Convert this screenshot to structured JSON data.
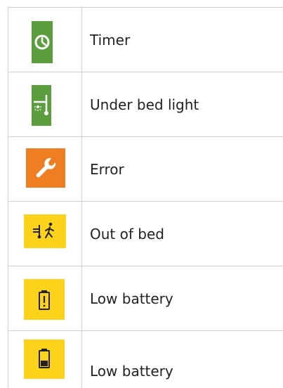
{
  "colors": {
    "green": "#5a9e3e",
    "orange": "#ef7d22",
    "yellow": "#fdd21a",
    "grid": "#cfcfcf",
    "text": "#222222"
  },
  "legend": {
    "rows": [
      {
        "label": "Timer",
        "icon": "timer-icon",
        "color": "green"
      },
      {
        "label": "Under bed light",
        "icon": "under-bed-light-icon",
        "color": "green"
      },
      {
        "label": "Error",
        "icon": "wrench-icon",
        "color": "orange"
      },
      {
        "label": "Out of bed",
        "icon": "out-of-bed-icon",
        "color": "yellow"
      },
      {
        "label": "Low battery",
        "icon": "battery-warning-icon",
        "color": "yellow"
      },
      {
        "label": "Low battery",
        "icon": "battery-icon",
        "color": "yellow"
      }
    ]
  }
}
